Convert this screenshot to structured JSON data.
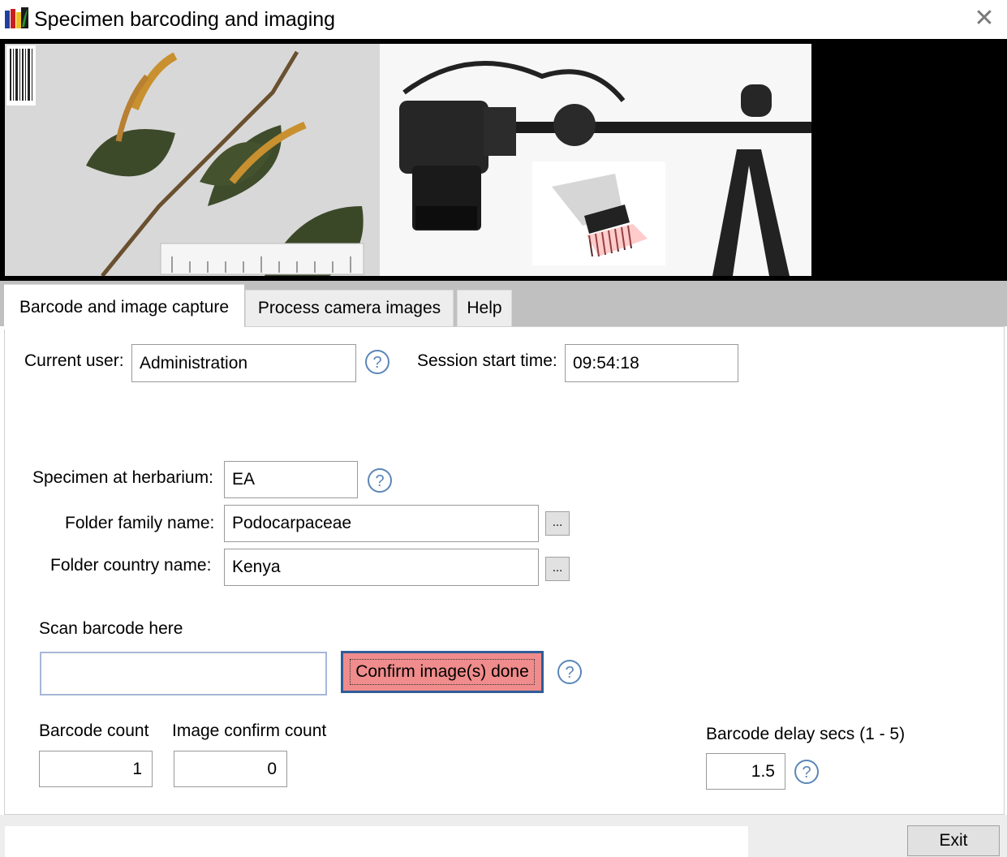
{
  "window": {
    "title": "Specimen barcoding and imaging"
  },
  "tabs": [
    {
      "label": "Barcode and image capture",
      "active": true
    },
    {
      "label": "Process camera images",
      "active": false
    },
    {
      "label": "Help",
      "active": false
    }
  ],
  "session": {
    "user_label": "Current user:",
    "user_value": "Administration",
    "start_label": "Session start time:",
    "start_value": "09:54:18"
  },
  "folder": {
    "herbarium_label": "Specimen at herbarium:",
    "herbarium_value": "EA",
    "family_label": "Folder family name:",
    "family_value": "Podocarpaceae",
    "country_label": "Folder country name:",
    "country_value": "Kenya",
    "browse_label": "..."
  },
  "scan": {
    "label": "Scan barcode here",
    "value": "",
    "confirm_label": "Confirm image(s) done"
  },
  "counts": {
    "barcode_label": "Barcode count",
    "barcode_value": "1",
    "image_label": "Image confirm count",
    "image_value": "0",
    "delay_label": "Barcode delay secs (1 - 5)",
    "delay_value": "1.5"
  },
  "footer": {
    "status": "",
    "exit_label": "Exit"
  },
  "icons": {
    "help": "help-icon",
    "close": "close-icon",
    "app": "app-icon"
  },
  "colors": {
    "confirm_bg": "#f08c8c",
    "confirm_border": "#2f5d98",
    "help_icon": "#5b86b8"
  }
}
